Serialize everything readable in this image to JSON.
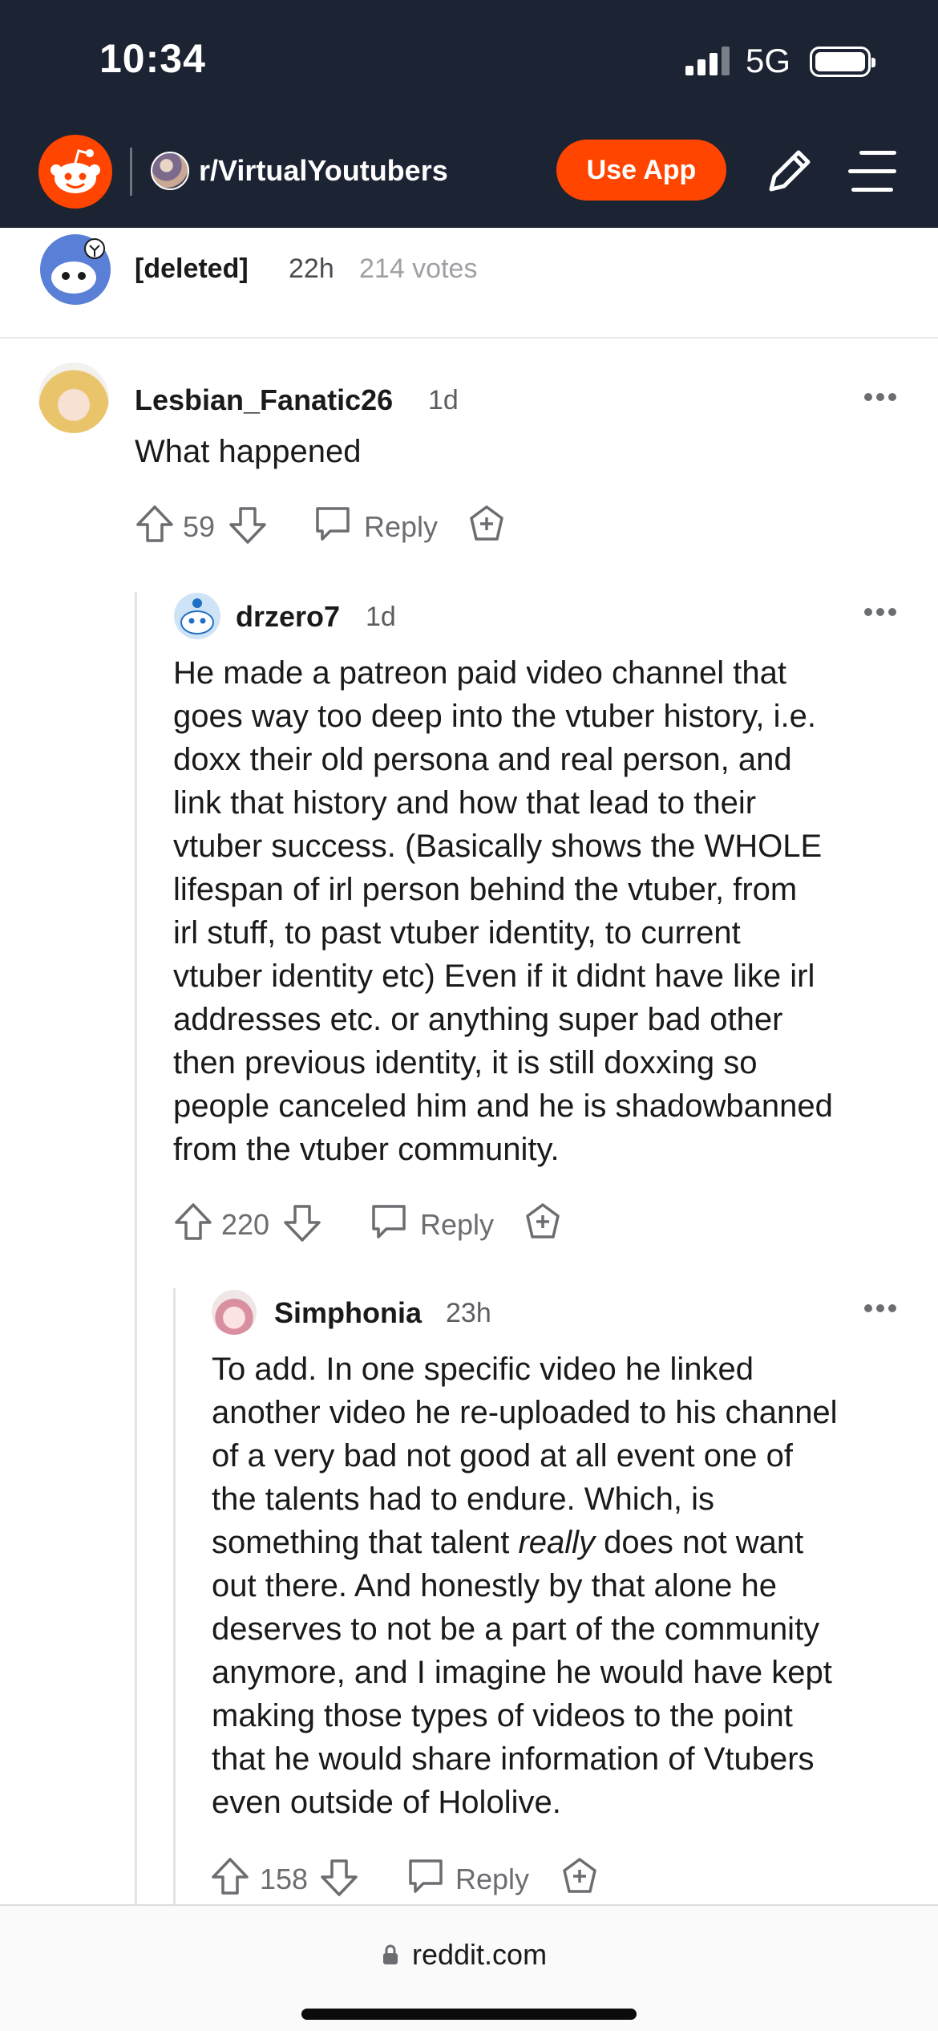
{
  "status_bar": {
    "time": "10:34",
    "network": "5G"
  },
  "header": {
    "subreddit": "r/VirtualYoutubers",
    "use_app_label": "Use App"
  },
  "deleted_row": {
    "user": "[deleted]",
    "time": "22h",
    "votes": "214 votes"
  },
  "comments": [
    {
      "author": "Lesbian_Fanatic26",
      "time": "1d",
      "body": "What happened",
      "score": "59",
      "reply_label": "Reply"
    },
    {
      "author": "drzero7",
      "time": "1d",
      "body": "He made a patreon paid video channel that\ngoes way too deep into the vtuber history, i.e.\ndoxx their old persona and real person, and\nlink that history and how that lead to their\nvtuber success. (Basically shows the WHOLE\nlifespan of irl person behind the vtuber, from\nirl stuff, to past vtuber identity, to current\nvtuber identity etc) Even if it didnt have like irl\naddresses etc. or anything super bad other\nthen previous identity, it is still doxxing so\npeople canceled him and he is shadowbanned\nfrom the vtuber community.",
      "score": "220",
      "reply_label": "Reply"
    },
    {
      "author": "Simphonia",
      "time": "23h",
      "body_parts": {
        "before": "To add. In one specific video he linked\nanother video he re-uploaded to his channel\nof a very bad not good at all event one of\nthe talents had to endure. Which, is\nsomething that talent ",
        "emphasis": "really",
        "after": " does not want\nout there. And honestly by that alone he\ndeserves to not be a part of the community\nanymore, and I imagine he would have kept\nmaking those types of videos to the point\nthat he would share information of Vtubers\neven outside of Hololive."
      },
      "score": "158",
      "reply_label": "Reply"
    }
  ],
  "bottom_bar": {
    "domain": "reddit.com"
  },
  "colors": {
    "header_bg": "#1c2333",
    "accent": "#ff4500"
  },
  "icons": [
    "reddit-logo-icon",
    "pencil-icon",
    "menu-icon",
    "more-icon",
    "upvote-icon",
    "downvote-icon",
    "reply-icon",
    "award-icon",
    "lock-icon"
  ]
}
